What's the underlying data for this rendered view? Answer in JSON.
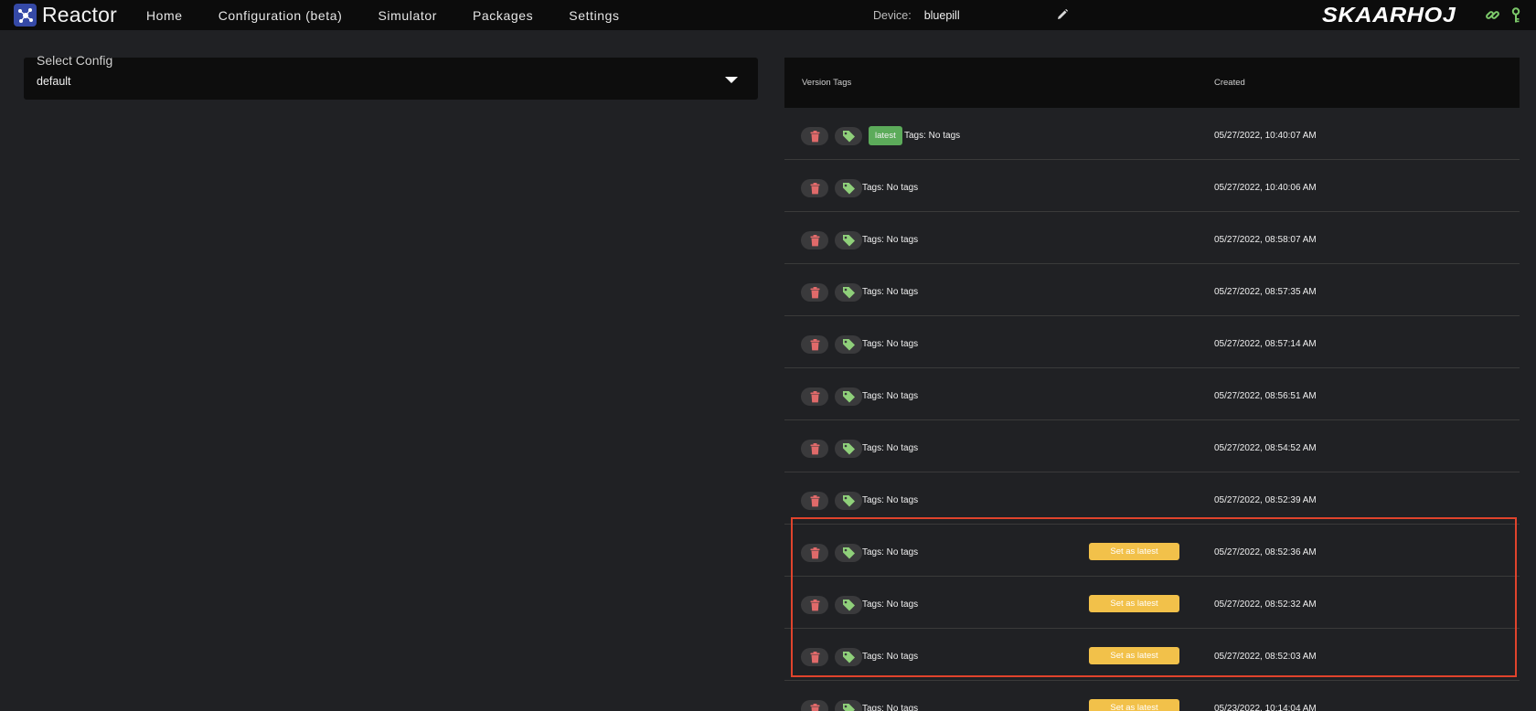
{
  "app": {
    "name": "Reactor"
  },
  "nav": {
    "items": [
      "Home",
      "Configuration (beta)",
      "Simulator",
      "Packages",
      "Settings"
    ]
  },
  "device": {
    "label": "Device:",
    "value": "bluepill"
  },
  "brand": {
    "logo_text": "SKAARHOJ"
  },
  "select_config": {
    "label": "Select Config",
    "value": "default"
  },
  "table": {
    "headers": {
      "version_tags": "Version Tags",
      "created": "Created"
    },
    "rows": [
      {
        "latest": "latest",
        "tags": "Tags: No tags",
        "set_latest": "",
        "created": "05/27/2022, 10:40:07 AM"
      },
      {
        "latest": "",
        "tags": "Tags: No tags",
        "set_latest": "",
        "created": "05/27/2022, 10:40:06 AM"
      },
      {
        "latest": "",
        "tags": "Tags: No tags",
        "set_latest": "",
        "created": "05/27/2022, 08:58:07 AM"
      },
      {
        "latest": "",
        "tags": "Tags: No tags",
        "set_latest": "",
        "created": "05/27/2022, 08:57:35 AM"
      },
      {
        "latest": "",
        "tags": "Tags: No tags",
        "set_latest": "",
        "created": "05/27/2022, 08:57:14 AM"
      },
      {
        "latest": "",
        "tags": "Tags: No tags",
        "set_latest": "",
        "created": "05/27/2022, 08:56:51 AM"
      },
      {
        "latest": "",
        "tags": "Tags: No tags",
        "set_latest": "",
        "created": "05/27/2022, 08:54:52 AM"
      },
      {
        "latest": "",
        "tags": "Tags: No tags",
        "set_latest": "",
        "created": "05/27/2022, 08:52:39 AM"
      },
      {
        "latest": "",
        "tags": "Tags: No tags",
        "set_latest": "Set as latest",
        "created": "05/27/2022, 08:52:36 AM"
      },
      {
        "latest": "",
        "tags": "Tags: No tags",
        "set_latest": "Set as latest",
        "created": "05/27/2022, 08:52:32 AM"
      },
      {
        "latest": "",
        "tags": "Tags: No tags",
        "set_latest": "Set as latest",
        "created": "05/27/2022, 08:52:03 AM"
      },
      {
        "latest": "",
        "tags": "Tags: No tags",
        "set_latest": "Set as latest",
        "created": "05/23/2022, 10:14:04 AM"
      }
    ]
  },
  "colors": {
    "accent_green": "#5cab5a",
    "set_latest_yellow": "#f2c14a",
    "delete_red": "#e06a6a",
    "tag_green": "#8fd07a",
    "highlight_red": "#e0432c"
  },
  "icons": [
    "reactor-logo-icon",
    "pencil-icon",
    "link-icon",
    "key-icon",
    "trash-icon",
    "tag-icon",
    "chevron-down-icon"
  ]
}
